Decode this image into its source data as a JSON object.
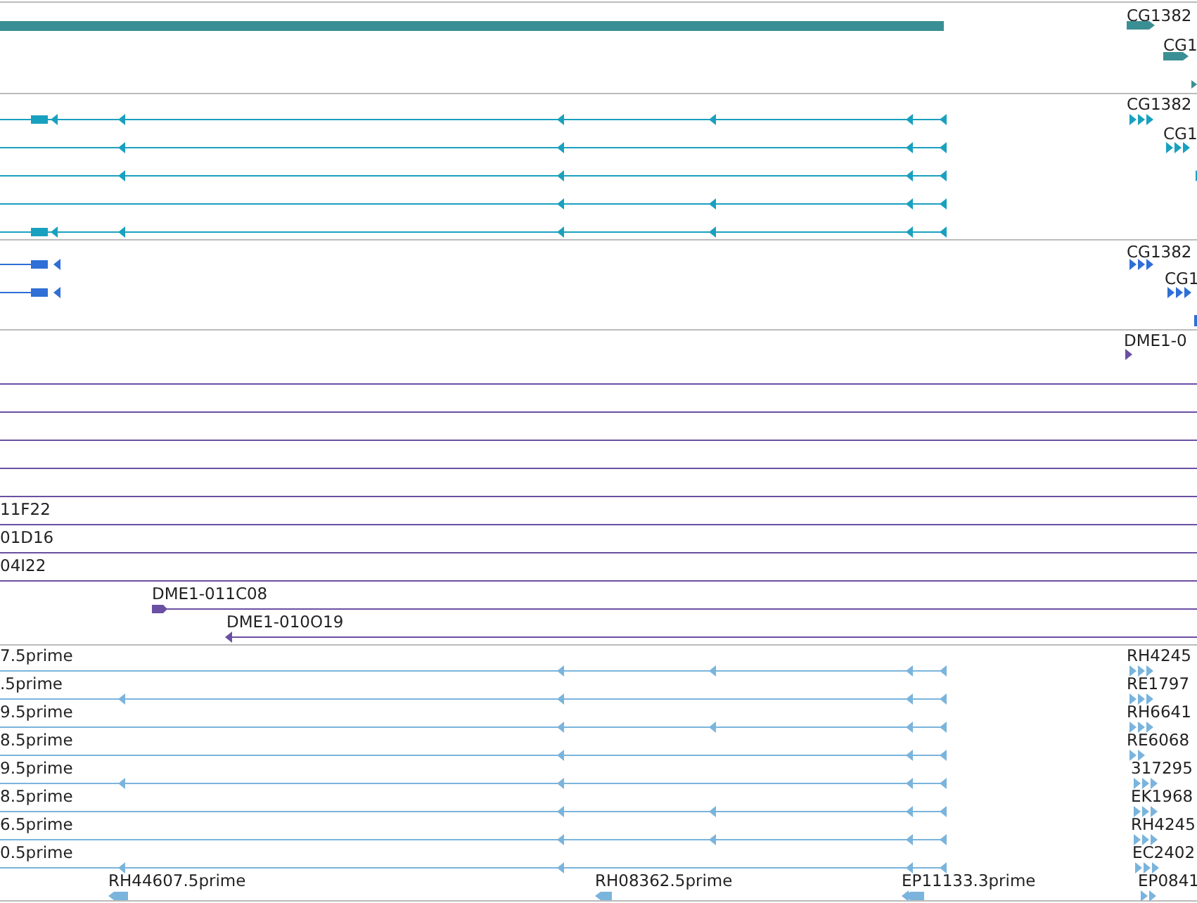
{
  "tracks": [
    {
      "kind": "gene",
      "color": "#3a8f94",
      "labels": [
        "CG1382",
        "CG1"
      ]
    },
    {
      "kind": "transcript",
      "color": "#1aa0bf",
      "labels": [
        "CG1382",
        "CG1"
      ]
    },
    {
      "kind": "transcript",
      "color": "#2f6fd6",
      "labels": [
        "CG1382",
        "CG1"
      ]
    },
    {
      "kind": "clone",
      "color": "#6a4fa3",
      "labels": [
        "DME1-0",
        "11F22",
        "01D16",
        "04I22",
        "DME1-011C08",
        "DME1-010O19"
      ]
    },
    {
      "kind": "est",
      "color": "#7ab4dc",
      "labels": [
        "7.5prime",
        ".5prime",
        "9.5prime",
        "8.5prime",
        "9.5prime",
        "8.5prime",
        "6.5prime",
        "0.5prime",
        "RH44607.5prime",
        "RH08362.5prime",
        "EP11133.3prime",
        "RH4245",
        "RE1797",
        "RH6641",
        "RE6068",
        "317295",
        "EK1968",
        "RH4245",
        "EC2402",
        "EP0841"
      ]
    }
  ]
}
